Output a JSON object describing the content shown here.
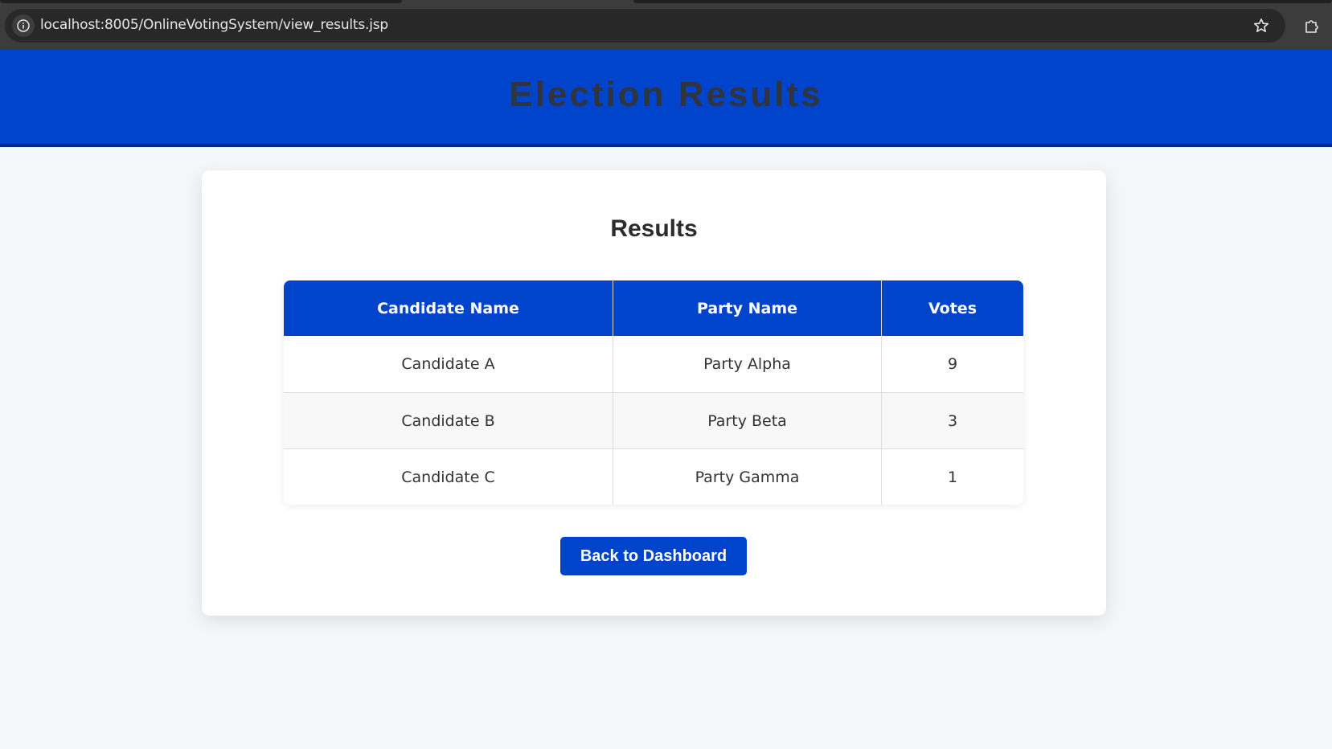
{
  "browser": {
    "url": "localhost:8005/OnlineVotingSystem/view_results.jsp",
    "icons": [
      "info-icon",
      "star-icon",
      "extensions-icon"
    ]
  },
  "header": {
    "title": "Election Results",
    "background_color": "#0044cc"
  },
  "card": {
    "title": "Results"
  },
  "table": {
    "columns": [
      "Candidate Name",
      "Party Name",
      "Votes"
    ],
    "rows": [
      [
        "Candidate A",
        "Party Alpha",
        "9"
      ],
      [
        "Candidate B",
        "Party Beta",
        "3"
      ],
      [
        "Candidate C",
        "Party Gamma",
        "1"
      ]
    ]
  },
  "actions": {
    "back_label": "Back to Dashboard"
  },
  "colors": {
    "accent": "#0044cc",
    "page_background": "#f4f6fa",
    "browser_chrome": "#3c3c3c"
  }
}
